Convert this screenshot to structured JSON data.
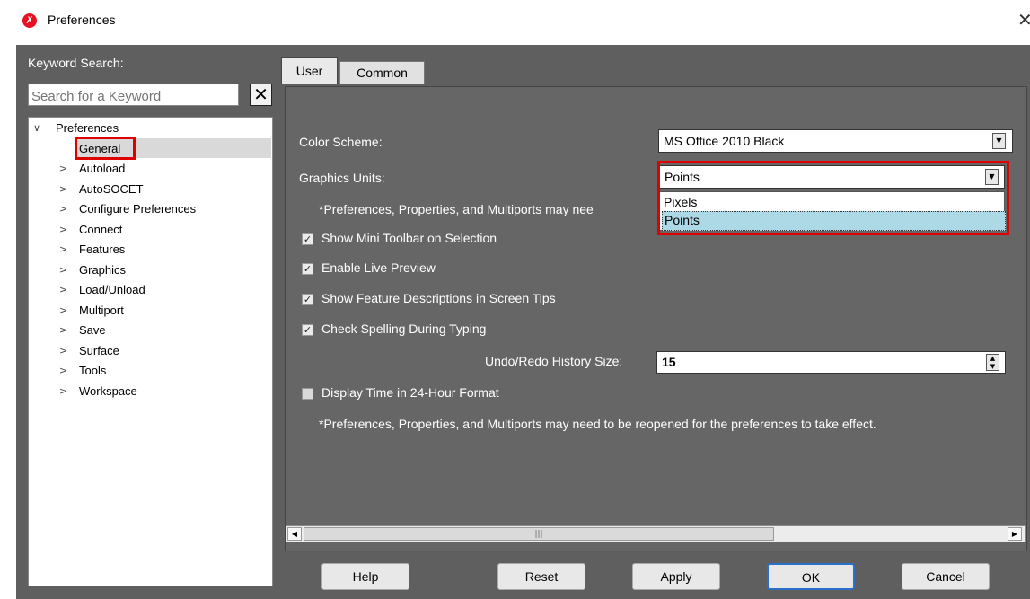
{
  "window": {
    "title": "Preferences",
    "close_glyph": "✕"
  },
  "search": {
    "label": "Keyword Search:",
    "placeholder": "Search for a Keyword",
    "clear_glyph": "✕"
  },
  "tree": {
    "root": "Preferences",
    "items": [
      "General",
      "Autoload",
      "AutoSOCET",
      "Configure Preferences",
      "Connect",
      "Features",
      "Graphics",
      "Load/Unload",
      "Multiport",
      "Save",
      "Surface",
      "Tools",
      "Workspace"
    ],
    "selected": "General"
  },
  "tabs": [
    {
      "label": "User",
      "active": true
    },
    {
      "label": "Common",
      "active": false
    }
  ],
  "settings": {
    "color_scheme_label": "Color Scheme:",
    "color_scheme_value": "MS Office 2010 Black",
    "graphics_units_label": "Graphics Units:",
    "graphics_units_value": "Points",
    "graphics_units_options": [
      "Pixels",
      "Points"
    ],
    "graphics_units_highlighted": "Points",
    "note_truncated": "*Preferences, Properties, and Multiports may nee",
    "show_mini_toolbar": "Show Mini Toolbar on Selection",
    "enable_live_preview": "Enable Live Preview",
    "show_feature_descriptions": "Show Feature Descriptions in Screen Tips",
    "check_spelling": "Check Spelling During Typing",
    "undo_label": "Undo/Redo History Size:",
    "undo_value": "15",
    "display_time_24h": "Display Time in 24-Hour Format",
    "note_full": "*Preferences, Properties, and Multiports may need to be reopened for the preferences to take effect.",
    "check_glyph": "✓"
  },
  "buttons": {
    "help": "Help",
    "reset": "Reset",
    "apply": "Apply",
    "ok": "OK",
    "cancel": "Cancel"
  },
  "colors": {
    "highlight_red": "#e00000",
    "panel": "#666666",
    "frame": "#5f5f5f",
    "selection": "#add8e6"
  }
}
